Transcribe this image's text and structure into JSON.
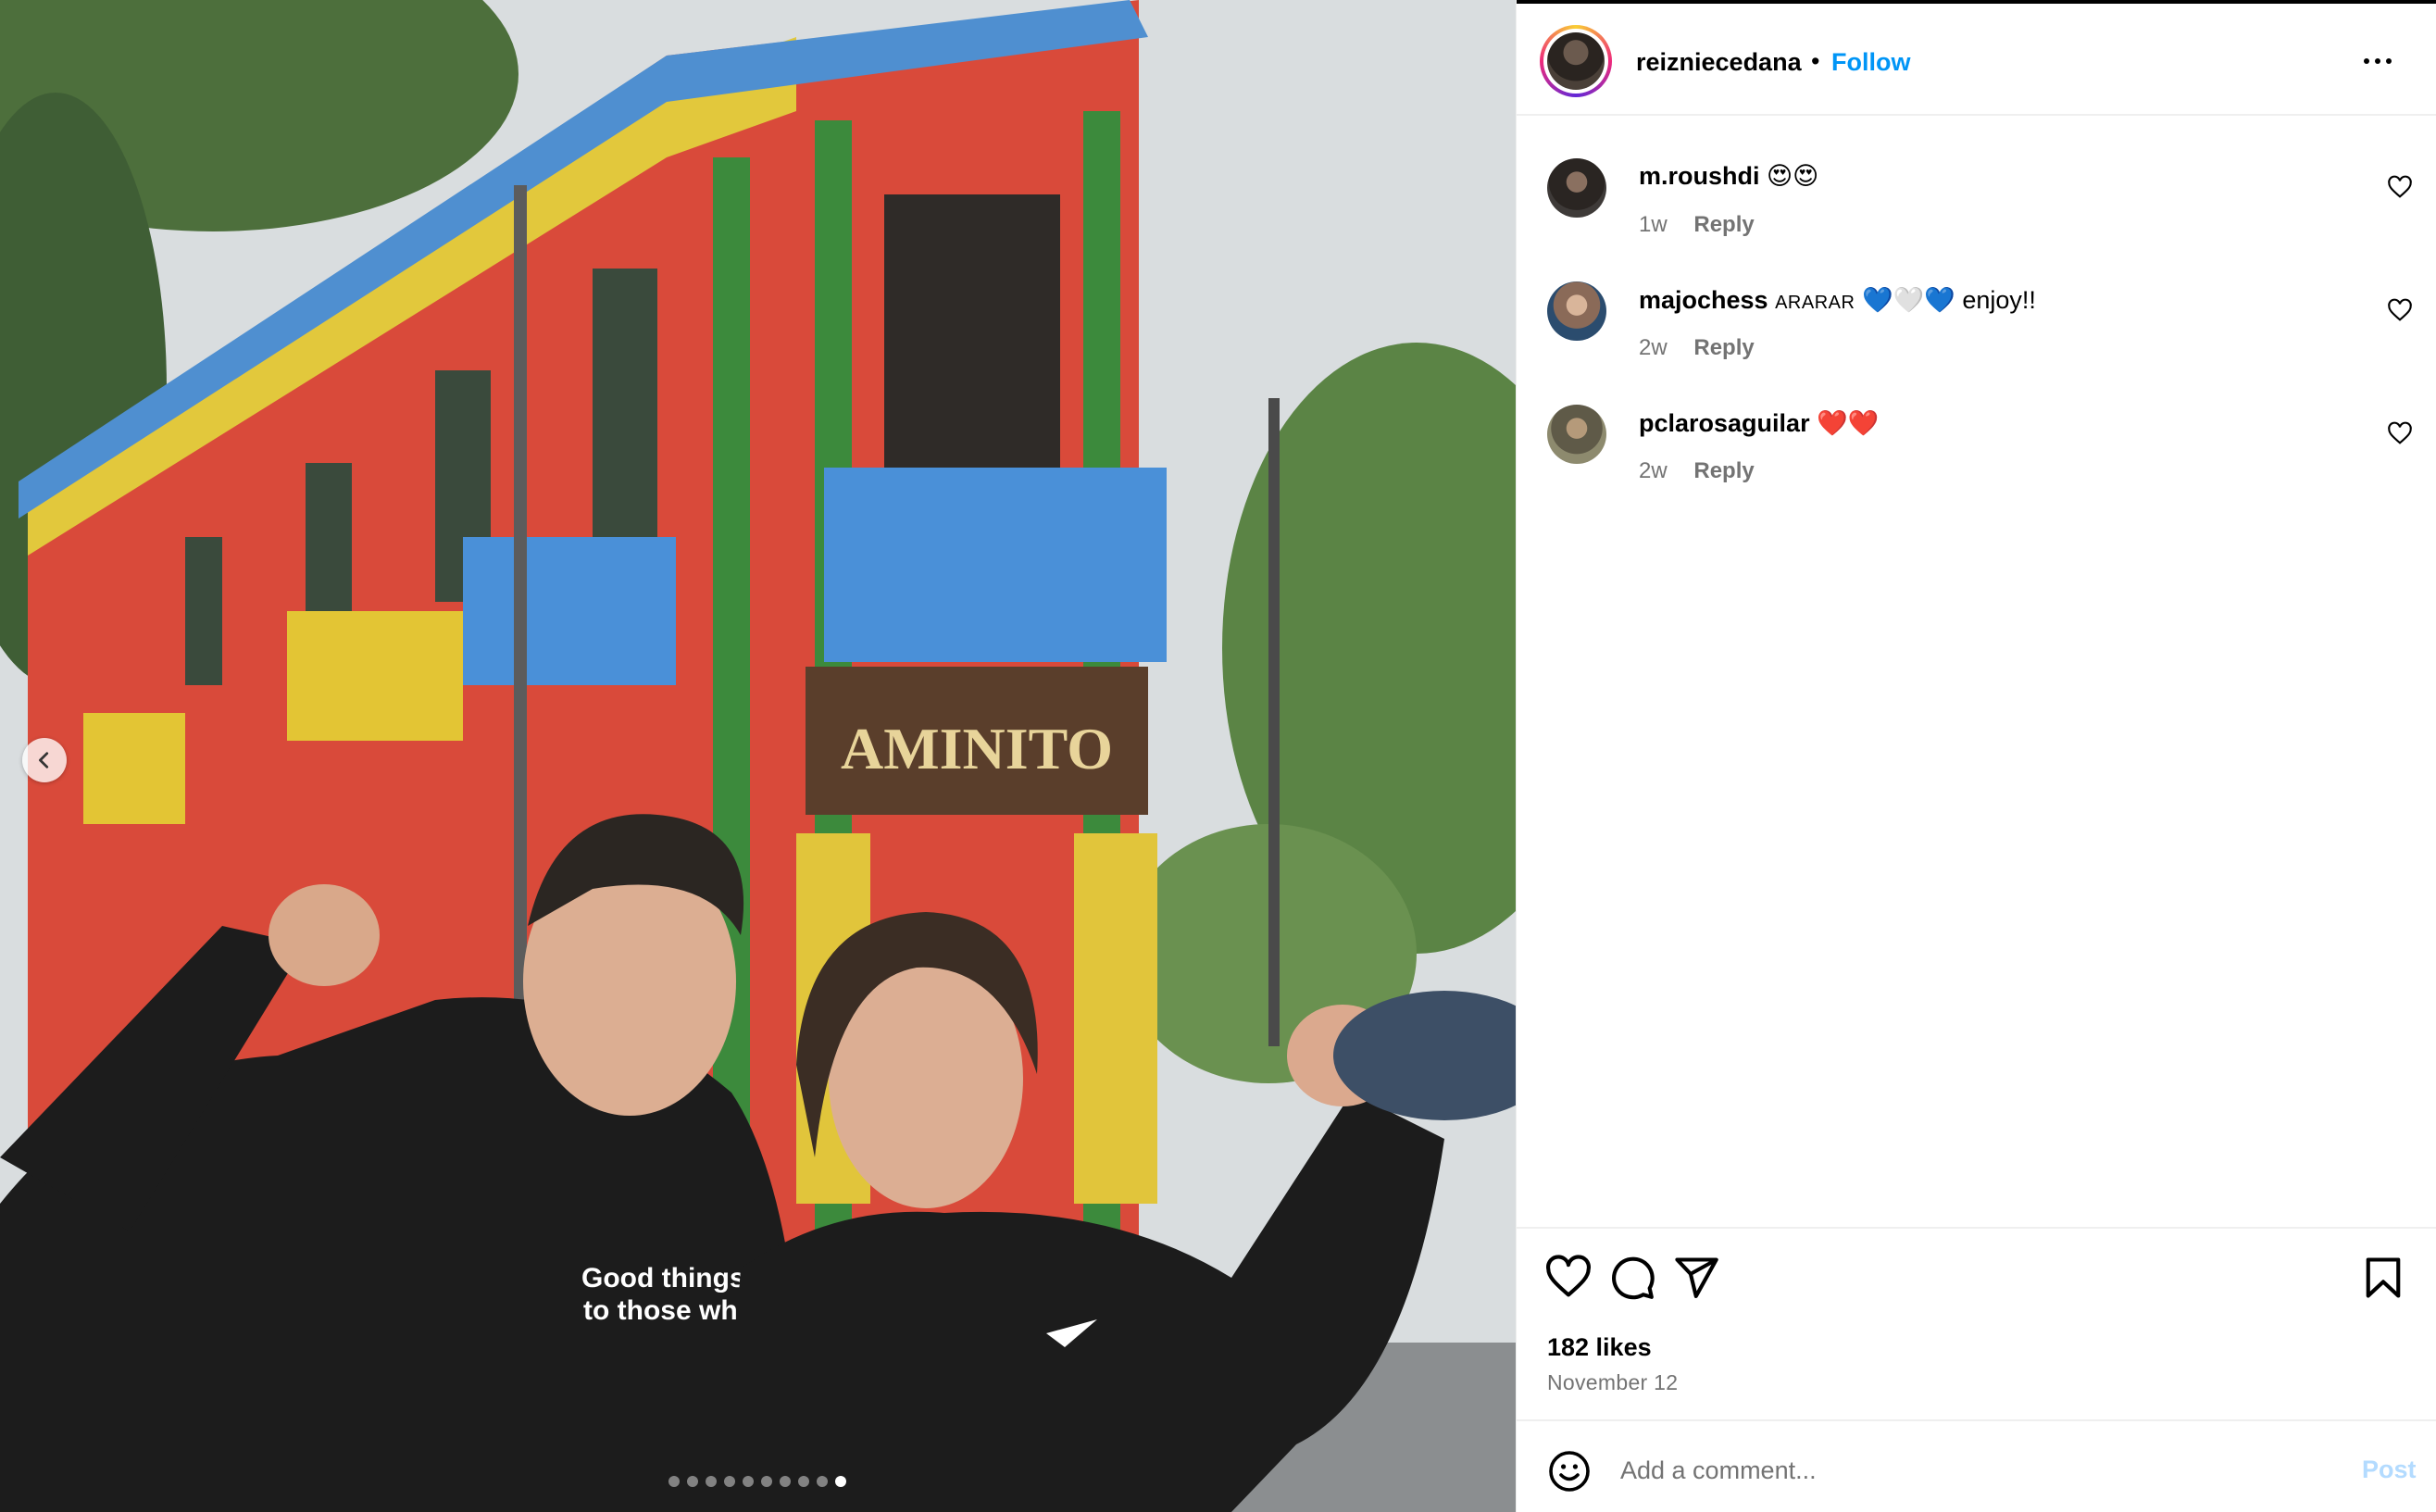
{
  "post": {
    "author": "reizniecedana",
    "separator": "•",
    "follow_label": "Follow",
    "image_description_icon": "photo-image",
    "carousel": {
      "total": 10,
      "active_index": 9
    }
  },
  "comments": [
    {
      "username": "m.roushdi",
      "extra": "",
      "text": "😍😍",
      "time": "1w",
      "reply_label": "Reply"
    },
    {
      "username": "majochess",
      "extra": "ARARAR",
      "text": "💙🤍💙 enjoy!!",
      "time": "2w",
      "reply_label": "Reply"
    },
    {
      "username": "pclarosaguilar",
      "extra": "",
      "text": "❤️❤️",
      "time": "2w",
      "reply_label": "Reply"
    }
  ],
  "engagement": {
    "likes_text": "182 likes",
    "date_text": "November 12"
  },
  "composer": {
    "placeholder": "Add a comment...",
    "post_label": "Post"
  },
  "colors": {
    "follow_blue": "#0095f6",
    "post_disabled": "#b3dbff",
    "meta_gray": "#737373",
    "divider": "#efefef"
  },
  "icons": [
    "chevron-left-icon",
    "more-icon",
    "heart-icon",
    "comment-icon",
    "share-icon",
    "bookmark-icon",
    "emoji-icon"
  ]
}
